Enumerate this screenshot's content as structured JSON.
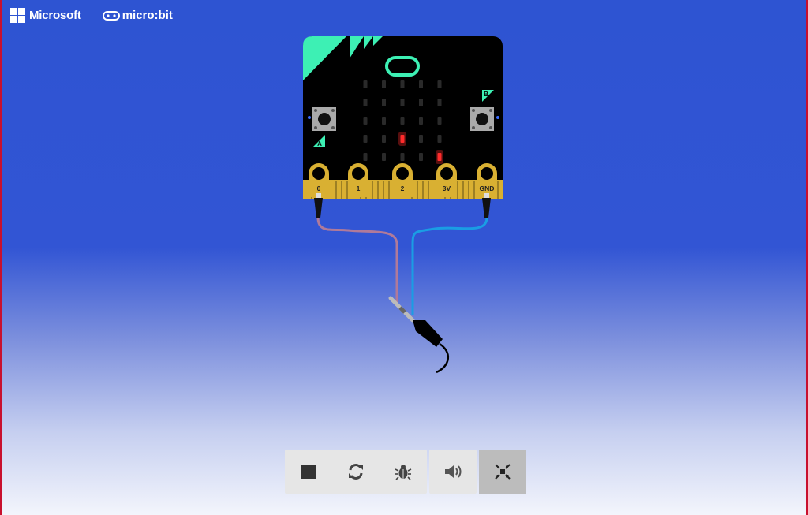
{
  "brand": {
    "microsoft_label": "Microsoft",
    "microbit_label": "micro:bit"
  },
  "board": {
    "button_a_label": "A",
    "button_b_label": "B",
    "pins": [
      "0",
      "1",
      "2",
      "3V",
      "GND"
    ],
    "led_rows": 5,
    "led_cols": 5,
    "lit_leds": [
      [
        3,
        2
      ],
      [
        4,
        4
      ]
    ],
    "colors": {
      "board": "#000000",
      "accent": "#3df0b4",
      "edge": "#d9b032",
      "led_on": "#ff2b2b",
      "wire_pin0": "#b07a9a",
      "wire_gnd": "#1a9de4"
    }
  },
  "toolbar": {
    "buttons": [
      {
        "name": "stop-button",
        "icon": "stop-icon"
      },
      {
        "name": "restart-button",
        "icon": "restart-icon"
      },
      {
        "name": "debug-button",
        "icon": "bug-icon"
      },
      {
        "name": "mute-button",
        "icon": "speaker-icon"
      },
      {
        "name": "exit-fullscreen-button",
        "icon": "collapse-icon"
      }
    ]
  }
}
